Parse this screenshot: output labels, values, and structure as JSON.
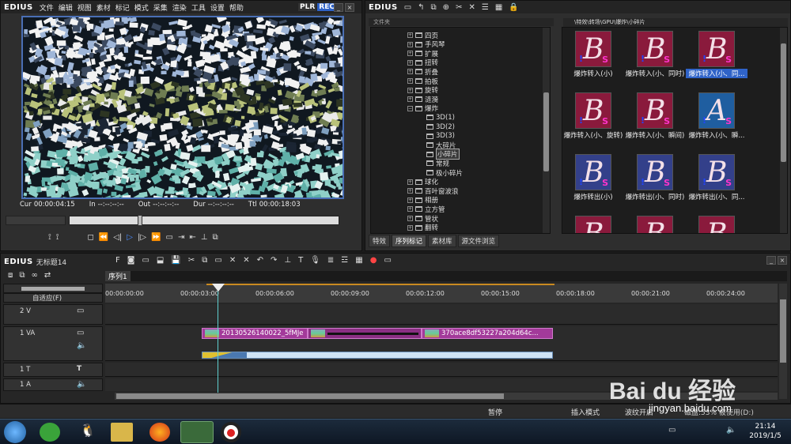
{
  "player": {
    "app_logo": "EDIUS",
    "menu": [
      "文件",
      "编辑",
      "视图",
      "素材",
      "标记",
      "模式",
      "采集",
      "渲染",
      "工具",
      "设置",
      "帮助"
    ],
    "mode_plr": "PLR",
    "mode_rec": "REC",
    "timecodes": [
      {
        "label": "Cur",
        "value": "00:00:04:15"
      },
      {
        "label": "In",
        "value": "--:--:--:--"
      },
      {
        "label": "Out",
        "value": "--:--:--:--"
      },
      {
        "label": "Dur",
        "value": "--:--:--:--"
      },
      {
        "label": "Ttl",
        "value": "00:00:18:03"
      }
    ]
  },
  "library": {
    "app_logo": "EDIUS",
    "tree_header": "文件夹",
    "path": "\\特效\\转场\\GPU\\爆炸\\小碎片",
    "tree_items": [
      "四页",
      "手风琴",
      "扩展",
      "扭转",
      "折叠",
      "拍板",
      "旋转",
      "涟漪",
      "爆炸",
      "3D(1)",
      "3D(2)",
      "3D(3)",
      "大碎片",
      "小碎片",
      "常规",
      "极小碎片",
      "球化",
      "百叶窗波浪",
      "相册",
      "立方管",
      "管状",
      "翻转"
    ],
    "selected_tree_item": "小碎片",
    "thumbs": [
      {
        "letter": "B",
        "caption": "爆炸转入(小)",
        "selected": false
      },
      {
        "letter": "B",
        "caption": "爆炸转入(小、同时)",
        "selected": false
      },
      {
        "letter": "B",
        "caption": "爆炸转入(小、同...",
        "selected": true
      },
      {
        "letter": "B",
        "caption": "爆炸转入(小、旋转)",
        "selected": false
      },
      {
        "letter": "B",
        "caption": "爆炸转入(小、瞬间)",
        "selected": false
      },
      {
        "letter": "A",
        "caption": "爆炸转入(小、瞬...",
        "selected": false
      },
      {
        "letter": "B",
        "caption": "爆炸转出(小)",
        "selected": false
      },
      {
        "letter": "B",
        "caption": "爆炸转出(小、同时)",
        "selected": false
      },
      {
        "letter": "B",
        "caption": "爆炸转出(小、同...",
        "selected": false
      },
      {
        "letter": "B",
        "caption": "",
        "selected": false
      },
      {
        "letter": "B",
        "caption": "",
        "selected": false
      },
      {
        "letter": "B",
        "caption": "",
        "selected": false
      }
    ],
    "tabs": [
      "特效",
      "序列标记",
      "素材库",
      "源文件浏览"
    ],
    "active_tab": "序列标记"
  },
  "timeline": {
    "app_logo": "EDIUS",
    "project_name": "无标题14",
    "sequence_tab": "序列1",
    "fit_label": "自适应(F)",
    "ruler": [
      "00:00:00:00",
      "00:00:03:00",
      "00:00:06:00",
      "00:00:09:00",
      "00:00:12:00",
      "00:00:15:00",
      "00:00:18:00",
      "00:00:21:00",
      "00:00:24:00"
    ],
    "tracks": [
      {
        "name": "2 V"
      },
      {
        "name": "1 VA"
      },
      {
        "name": "1 T"
      },
      {
        "name": "1 A"
      }
    ],
    "clip1": "20130526140022_5fMJe",
    "clip2": "370ace8df53227a204d64c..."
  },
  "status": {
    "pause": "暂停",
    "insert_mode": "插入模式",
    "ripple": "波纹开启",
    "disk": "磁盘:53% 被使用(D:)"
  },
  "taskbar": {
    "time": "21:14",
    "date": "2019/1/5"
  },
  "watermark": {
    "brand": "Bai du 经验",
    "url": "jingyan.baidu.com"
  },
  "colors": {
    "accent": "#2f63c8",
    "clip": "#a33a9a",
    "playhead": "#5fd0d0",
    "rec": "#2f63c8"
  }
}
